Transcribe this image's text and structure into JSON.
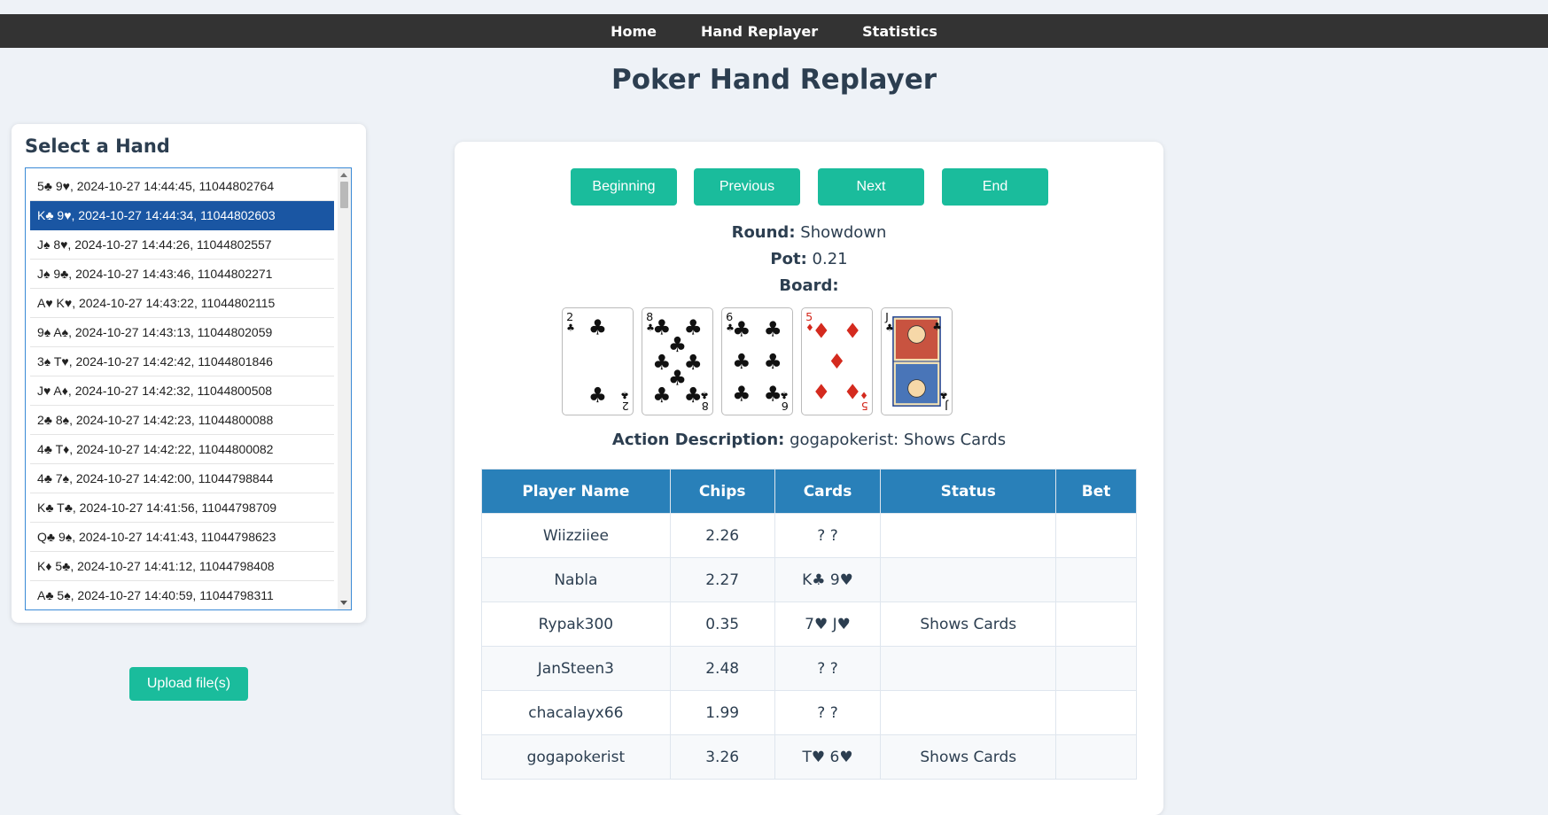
{
  "nav": {
    "items": [
      "Home",
      "Hand Replayer",
      "Statistics"
    ]
  },
  "page": {
    "title": "Poker Hand Replayer"
  },
  "hand_select": {
    "heading": "Select a Hand",
    "hands": [
      "5♣ 9♥, 2024-10-27 14:44:45, 11044802764",
      "K♣ 9♥, 2024-10-27 14:44:34, 11044802603",
      "J♠ 8♥, 2024-10-27 14:44:26, 11044802557",
      "J♠ 9♣, 2024-10-27 14:43:46, 11044802271",
      "A♥ K♥, 2024-10-27 14:43:22, 11044802115",
      "9♠ A♠, 2024-10-27 14:43:13, 11044802059",
      "3♠ T♥, 2024-10-27 14:42:42, 11044801846",
      "J♥ A♦, 2024-10-27 14:42:32, 11044800508",
      "2♣ 8♠, 2024-10-27 14:42:23, 11044800088",
      "4♣ T♦, 2024-10-27 14:42:22, 11044800082",
      "4♣ 7♠, 2024-10-27 14:42:00, 11044798844",
      "K♣ T♣, 2024-10-27 14:41:56, 11044798709",
      "Q♣ 9♠, 2024-10-27 14:41:43, 11044798623",
      "K♦ 5♣, 2024-10-27 14:41:12, 11044798408",
      "A♣ 5♠, 2024-10-27 14:40:59, 11044798311"
    ],
    "selected_index": 1,
    "upload_label": "Upload file(s)"
  },
  "controls": {
    "beginning": "Beginning",
    "previous": "Previous",
    "next": "Next",
    "end": "End"
  },
  "state": {
    "round_label": "Round:",
    "round": "Showdown",
    "pot_label": "Pot:",
    "pot": "0.21",
    "board_label": "Board:",
    "board": [
      {
        "rank": "2",
        "suit": "♣"
      },
      {
        "rank": "8",
        "suit": "♣"
      },
      {
        "rank": "6",
        "suit": "♣"
      },
      {
        "rank": "5",
        "suit": "♦"
      },
      {
        "rank": "J",
        "suit": "♣"
      }
    ],
    "action_label": "Action Description:",
    "action": "gogapokerist: Shows Cards"
  },
  "players_table": {
    "headers": [
      "Player Name",
      "Chips",
      "Cards",
      "Status",
      "Bet"
    ],
    "rows": [
      {
        "name": "Wiizziiee",
        "chips": "2.26",
        "cards": "? ?",
        "status": "",
        "bet": ""
      },
      {
        "name": "Nabla",
        "chips": "2.27",
        "cards": "K♣ 9♥",
        "status": "",
        "bet": ""
      },
      {
        "name": "Rypak300",
        "chips": "0.35",
        "cards": "7♥ J♥",
        "status": "Shows Cards",
        "bet": ""
      },
      {
        "name": "JanSteen3",
        "chips": "2.48",
        "cards": "? ?",
        "status": "",
        "bet": ""
      },
      {
        "name": "chacalayx66",
        "chips": "1.99",
        "cards": "? ?",
        "status": "",
        "bet": ""
      },
      {
        "name": "gogapokerist",
        "chips": "3.26",
        "cards": "T♥ 6♥",
        "status": "Shows Cards",
        "bet": ""
      }
    ]
  },
  "colors": {
    "accent": "#1abc9c",
    "table_header": "#2980b9",
    "selected_row": "#1a56a3",
    "navbar": "#333333",
    "title": "#2c3e50",
    "red_suit": "#d42a1e"
  }
}
